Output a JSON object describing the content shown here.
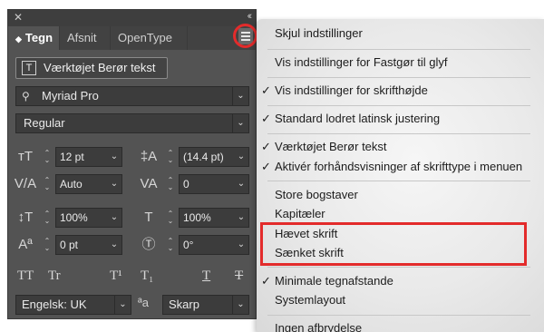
{
  "panel": {
    "close_glyph": "✕",
    "collapse_glyph": "‹‹",
    "tabs": [
      {
        "label": "Tegn",
        "active": true
      },
      {
        "label": "Afsnit",
        "active": false
      },
      {
        "label": "OpenType",
        "active": false
      }
    ],
    "touch_tool_label": "Værktøjet Berør tekst",
    "font_family": "Myriad Pro",
    "font_style": "Regular",
    "font_size": "12 pt",
    "leading": "(14.4 pt)",
    "kerning": "Auto",
    "tracking": "0",
    "vertical_scale": "100%",
    "horizontal_scale": "100%",
    "baseline_shift": "0 pt",
    "rotation": "0°",
    "language": "Engelsk: UK",
    "antialias": "Skarp",
    "antialias_icon": "ªa",
    "style_buttons": [
      "TT",
      "Tr",
      "T¹",
      "T₁",
      "T",
      "T"
    ]
  },
  "menu": {
    "items": [
      {
        "label": "Skjul indstillinger",
        "checked": false
      },
      {
        "label": "Vis indstillinger for Fastgør til glyf",
        "checked": false
      },
      {
        "label": "Vis indstillinger for skrifthøjde",
        "checked": true
      },
      {
        "label": "Standard lodret latinsk justering",
        "checked": true
      },
      {
        "label": "Værktøjet Berør tekst",
        "checked": true
      },
      {
        "label": "Aktivér forhåndsvisninger af skrifttype i menuen",
        "checked": true
      },
      {
        "label": "Store bogstaver",
        "checked": false
      },
      {
        "label": "Kapitæler",
        "checked": false
      },
      {
        "label": "Hævet skrift",
        "checked": false
      },
      {
        "label": "Sænket skrift",
        "checked": false
      },
      {
        "label": "Minimale tegnafstande",
        "checked": true
      },
      {
        "label": "Systemlayout",
        "checked": false
      },
      {
        "label": "Ingen afbrydelse",
        "checked": false
      }
    ],
    "check_glyph": "✓"
  },
  "colors": {
    "panel_bg": "#535353",
    "highlight": "#e32b2b",
    "menu_bg": "#ececec"
  }
}
